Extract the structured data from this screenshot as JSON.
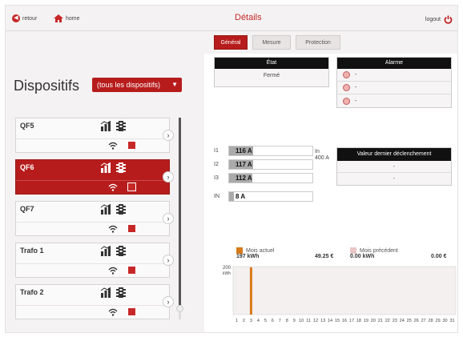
{
  "header": {
    "back_label": "retour",
    "home_label": "home",
    "title": "Détails",
    "logout_label": "logout"
  },
  "tabs": [
    {
      "label": "Général",
      "active": true
    },
    {
      "label": "Mesure",
      "active": false
    },
    {
      "label": "Protection",
      "active": false
    }
  ],
  "sidebar": {
    "title": "Dispositifs",
    "filter_value": "(tous les dispositifs)",
    "devices": [
      {
        "name": "QF5",
        "active": false
      },
      {
        "name": "QF6",
        "active": true
      },
      {
        "name": "QF7",
        "active": false
      },
      {
        "name": "Trafo 1",
        "active": false
      },
      {
        "name": "Trafo 2",
        "active": false
      }
    ]
  },
  "etat": {
    "header": "État",
    "value": "Fermé"
  },
  "alarme": {
    "header": "Alarme",
    "rows": [
      "-",
      "-",
      "-"
    ]
  },
  "currents": [
    {
      "label": "I1",
      "value": "116",
      "unit": "A",
      "fraction": 0.29
    },
    {
      "label": "I2",
      "value": "117",
      "unit": "A",
      "fraction": 0.29
    },
    {
      "label": "I3",
      "value": "112",
      "unit": "A",
      "fraction": 0.28
    },
    {
      "label": "IN",
      "value": "8",
      "unit": "A",
      "fraction": 0.02
    }
  ],
  "nominal": {
    "label": "In",
    "value": "400 A"
  },
  "last_trip": {
    "header": "Valeur dernier déclenchement",
    "rows": [
      "-",
      "-"
    ]
  },
  "energy": {
    "current_label": "Mois actuel",
    "current_kwh": "197 kWh",
    "current_eur": "49.25 €",
    "previous_label": "Mois précédent",
    "previous_kwh": "0.00 kWh",
    "previous_eur": "0.00 €"
  },
  "colors": {
    "accent": "#b71c1c",
    "current_month": "#d97a1a",
    "previous_month": "#e8c7c7"
  },
  "chart_data": {
    "type": "bar",
    "ylabel": "kWh",
    "ylim": [
      0,
      200
    ],
    "yticks": [
      200
    ],
    "categories": [
      "1",
      "2",
      "3",
      "4",
      "5",
      "6",
      "7",
      "8",
      "9",
      "10",
      "11",
      "12",
      "13",
      "14",
      "15",
      "16",
      "17",
      "18",
      "19",
      "20",
      "21",
      "22",
      "23",
      "24",
      "25",
      "26",
      "27",
      "28",
      "29",
      "30",
      "31"
    ],
    "series": [
      {
        "name": "Mois actuel",
        "values": [
          0,
          0,
          197,
          0,
          0,
          0,
          0,
          0,
          0,
          0,
          0,
          0,
          0,
          0,
          0,
          0,
          0,
          0,
          0,
          0,
          0,
          0,
          0,
          0,
          0,
          0,
          0,
          0,
          0,
          0,
          0
        ]
      },
      {
        "name": "Mois précédent",
        "values": [
          0,
          0,
          0,
          0,
          0,
          0,
          0,
          0,
          0,
          0,
          0,
          0,
          0,
          0,
          0,
          0,
          0,
          0,
          0,
          0,
          0,
          0,
          0,
          0,
          0,
          0,
          0,
          0,
          0,
          0,
          0
        ]
      }
    ]
  }
}
